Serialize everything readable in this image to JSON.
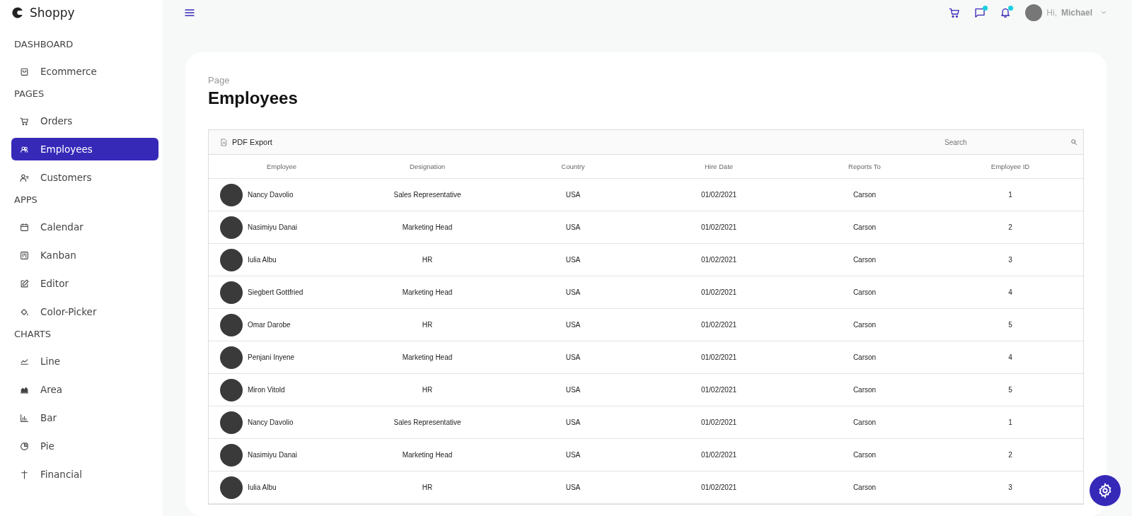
{
  "brand": {
    "name": "Shoppy"
  },
  "sidebar": {
    "sections": [
      {
        "title": "DASHBOARD",
        "items": [
          {
            "label": "Ecommerce",
            "selected": false
          }
        ]
      },
      {
        "title": "PAGES",
        "items": [
          {
            "label": "Orders",
            "selected": false
          },
          {
            "label": "Employees",
            "selected": true
          },
          {
            "label": "Customers",
            "selected": false
          }
        ]
      },
      {
        "title": "APPS",
        "items": [
          {
            "label": "Calendar",
            "selected": false
          },
          {
            "label": "Kanban",
            "selected": false
          },
          {
            "label": "Editor",
            "selected": false
          },
          {
            "label": "Color-Picker",
            "selected": false
          }
        ]
      },
      {
        "title": "CHARTS",
        "items": [
          {
            "label": "Line",
            "selected": false
          },
          {
            "label": "Area",
            "selected": false
          },
          {
            "label": "Bar",
            "selected": false
          },
          {
            "label": "Pie",
            "selected": false
          },
          {
            "label": "Financial",
            "selected": false
          }
        ]
      }
    ]
  },
  "header": {
    "notifications": [
      {
        "dot": false
      },
      {
        "dot": true
      },
      {
        "dot": true
      }
    ],
    "greeting": "Hi,",
    "user": "Michael"
  },
  "page": {
    "category": "Page",
    "title": "Employees"
  },
  "table": {
    "toolbar": {
      "export": "PDF Export",
      "search_placeholder": "Search"
    },
    "columns": [
      "Employee",
      "Designation",
      "Country",
      "Hire Date",
      "Reports To",
      "Employee ID"
    ],
    "rows": [
      [
        "Nancy Davolio",
        "Sales Representative",
        "USA",
        "01/02/2021",
        "Carson",
        "1"
      ],
      [
        "Nasimiyu Danai",
        "Marketing Head",
        "USA",
        "01/02/2021",
        "Carson",
        "2"
      ],
      [
        "Iulia Albu",
        "HR",
        "USA",
        "01/02/2021",
        "Carson",
        "3"
      ],
      [
        "Siegbert Gottfried",
        "Marketing Head",
        "USA",
        "01/02/2021",
        "Carson",
        "4"
      ],
      [
        "Omar Darobe",
        "HR",
        "USA",
        "01/02/2021",
        "Carson",
        "5"
      ],
      [
        "Penjani Inyene",
        "Marketing Head",
        "USA",
        "01/02/2021",
        "Carson",
        "4"
      ],
      [
        "Miron Vitold",
        "HR",
        "USA",
        "01/02/2021",
        "Carson",
        "5"
      ],
      [
        "Nancy Davolio",
        "Sales Representative",
        "USA",
        "01/02/2021",
        "Carson",
        "1"
      ],
      [
        "Nasimiyu Danai",
        "Marketing Head",
        "USA",
        "01/02/2021",
        "Carson",
        "2"
      ],
      [
        "Iulia Albu",
        "HR",
        "USA",
        "01/02/2021",
        "Carson",
        "3"
      ]
    ]
  }
}
